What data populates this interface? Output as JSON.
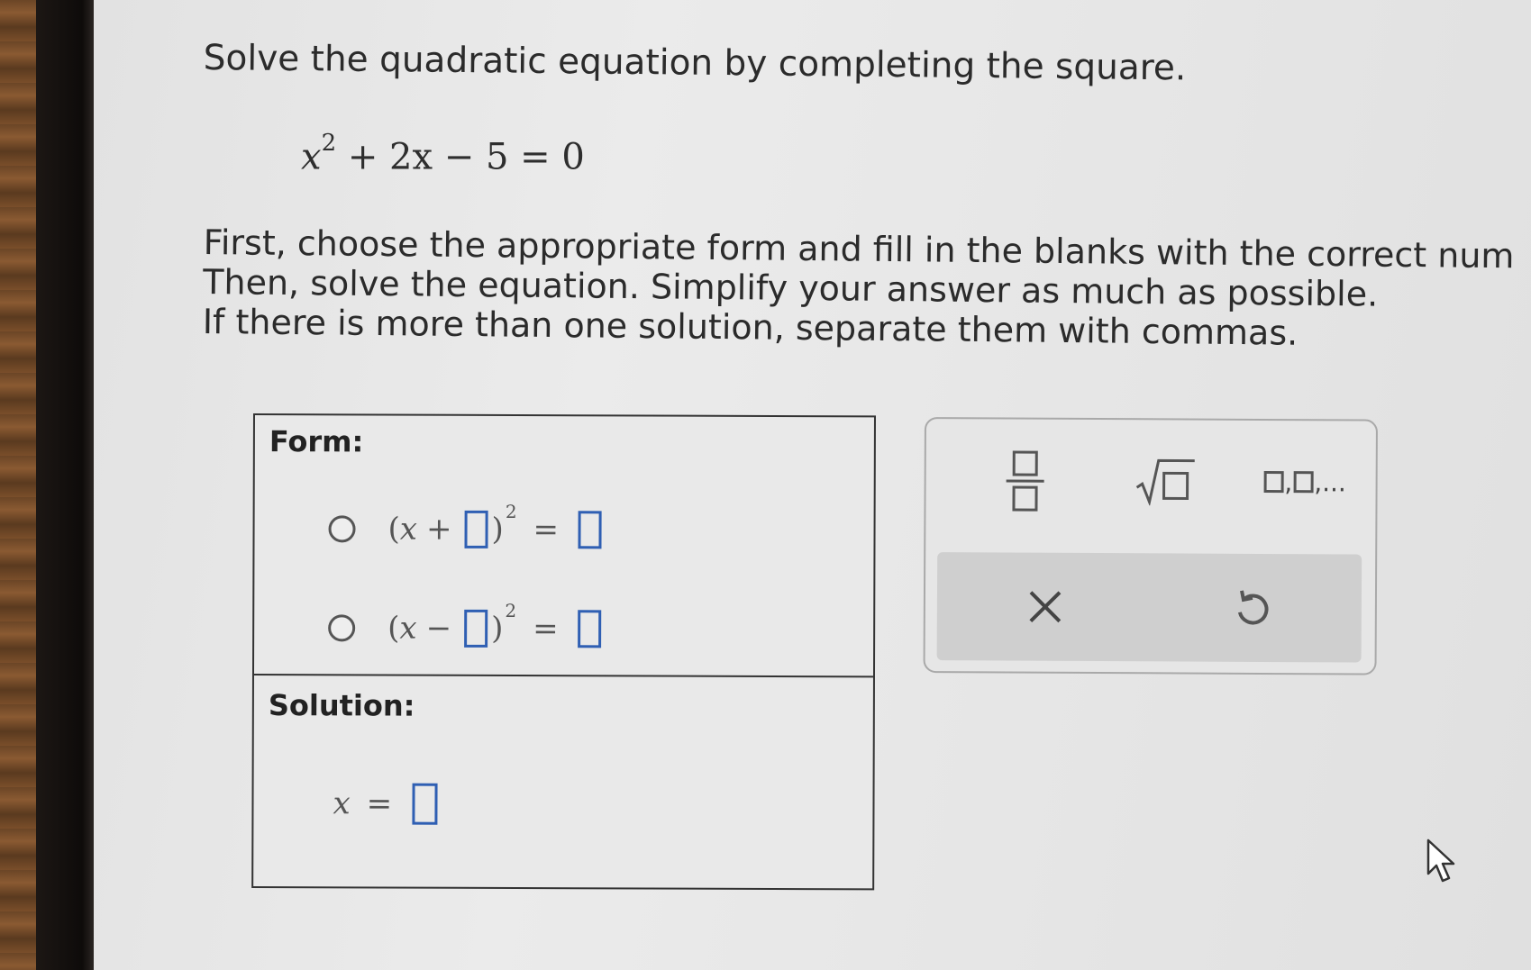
{
  "prompt": {
    "title": "Solve the quadratic equation by completing the square.",
    "equation": {
      "base": "x",
      "exp": "2",
      "rest": " + 2x − 5 = 0"
    },
    "instructions": [
      "First, choose the appropriate form and fill in the blanks with the correct num",
      "Then, solve the equation. Simplify your answer as much as possible.",
      "If there is more than one solution, separate them with commas."
    ]
  },
  "answer": {
    "form_label": "Form:",
    "options": [
      {
        "open": "(",
        "var": "x",
        "op": "+",
        "close": ")",
        "exp": "2",
        "eq": "="
      },
      {
        "open": "(",
        "var": "x",
        "op": "−",
        "close": ")",
        "exp": "2",
        "eq": "="
      }
    ],
    "solution_label": "Solution:",
    "solution": {
      "var": "x",
      "eq": "="
    }
  },
  "keypad": {
    "list_suffix": ",..."
  }
}
